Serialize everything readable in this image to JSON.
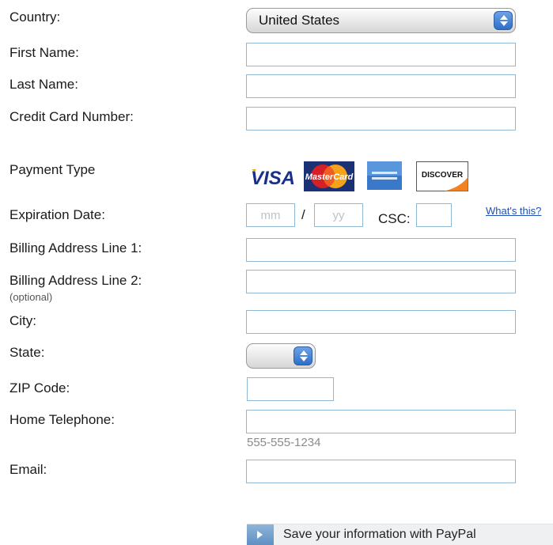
{
  "form": {
    "country": {
      "label": "Country:",
      "value": "United States"
    },
    "first_name": {
      "label": "First Name:",
      "value": ""
    },
    "last_name": {
      "label": "Last Name:",
      "value": ""
    },
    "card_number": {
      "label": "Credit Card Number:",
      "value": ""
    },
    "payment_type": {
      "label": "Payment Type",
      "cards": [
        {
          "name": "VISA",
          "icon": "visa-logo"
        },
        {
          "name": "MasterCard",
          "icon": "mastercard-logo"
        },
        {
          "name": "American Express",
          "icon": "amex-logo"
        },
        {
          "name": "DISCOVER",
          "icon": "discover-logo"
        }
      ]
    },
    "expiration": {
      "label": "Expiration Date:",
      "month_placeholder": "mm",
      "separator": "/",
      "year_placeholder": "yy",
      "csc_label": "CSC:",
      "whats_this": "What's this?"
    },
    "billing1": {
      "label": "Billing Address Line 1:",
      "value": ""
    },
    "billing2": {
      "label": "Billing Address Line 2:",
      "note": "(optional)",
      "value": ""
    },
    "city": {
      "label": "City:",
      "value": ""
    },
    "state": {
      "label": "State:",
      "value": ""
    },
    "zip": {
      "label": "ZIP Code:",
      "value": ""
    },
    "phone": {
      "label": "Home Telephone:",
      "value": "",
      "hint": "555-555-1234"
    },
    "email": {
      "label": "Email:",
      "value": ""
    }
  },
  "paypal": {
    "label": "Save your information with PayPal"
  },
  "colors": {
    "field_border": "#8fb8d6",
    "link": "#1f4fb5",
    "select_arrow": "#2e6fc8"
  }
}
